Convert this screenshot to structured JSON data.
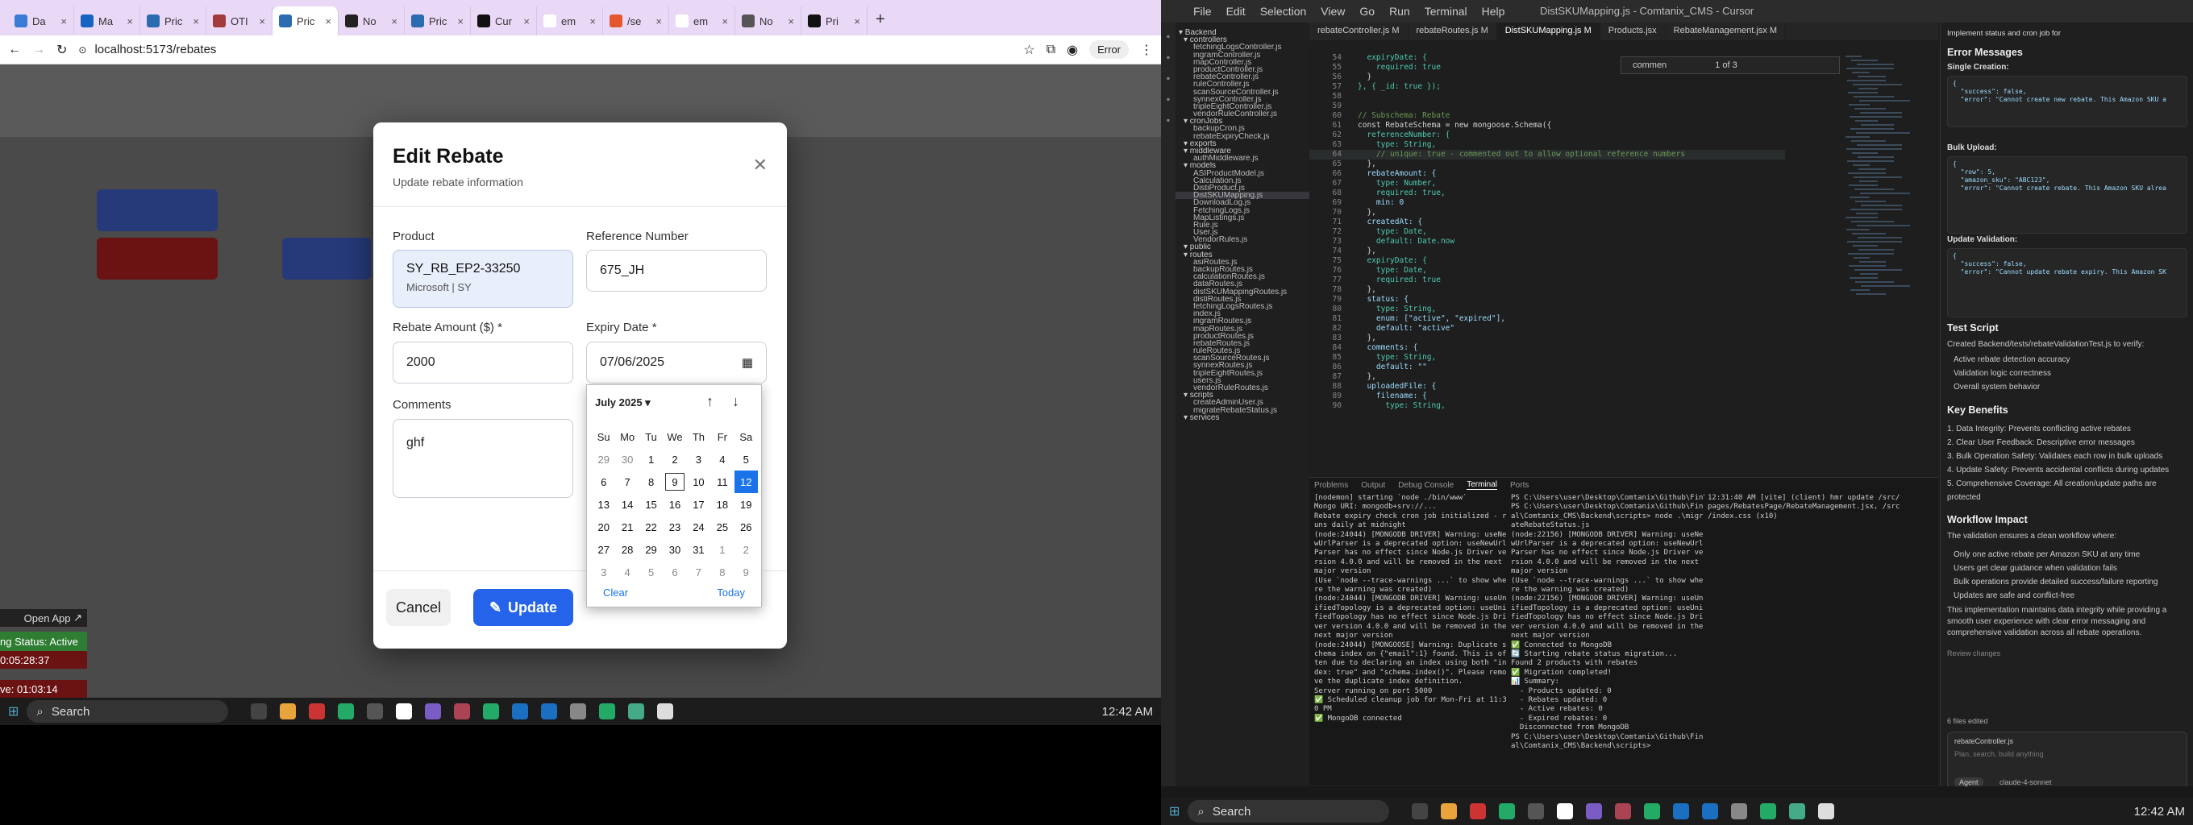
{
  "browser": {
    "tabs": [
      {
        "label": "Da"
      },
      {
        "label": "Ma"
      },
      {
        "label": "Pric"
      },
      {
        "label": "OTI"
      },
      {
        "label": "Pric"
      },
      {
        "label": "No"
      },
      {
        "label": "Pric"
      },
      {
        "label": "Cur"
      },
      {
        "label": "em"
      },
      {
        "label": "/se"
      },
      {
        "label": "em"
      },
      {
        "label": "No"
      },
      {
        "label": "Pri"
      }
    ],
    "url": "localhost:5173/rebates",
    "error_label": "Error"
  },
  "modal": {
    "title": "Edit Rebate",
    "subtitle": "Update rebate information",
    "product_label": "Product",
    "product_name": "SY_RB_EP2-33250",
    "product_meta": "Microsoft | SY",
    "reference_label": "Reference Number",
    "reference_value": "675_JH",
    "amount_label": "Rebate Amount ($) *",
    "amount_value": "2000",
    "expiry_label": "Expiry Date *",
    "expiry_value": "07/06/2025",
    "comments_label": "Comments",
    "comments_value": "ghf",
    "cancel_label": "Cancel",
    "update_label": "Update"
  },
  "calendar": {
    "month_label": "July 2025",
    "weekdays": [
      "Su",
      "Mo",
      "Tu",
      "We",
      "Th",
      "Fr",
      "Sa"
    ],
    "days": [
      "29",
      "30",
      "1",
      "2",
      "3",
      "4",
      "5",
      "6",
      "7",
      "8",
      "9",
      "10",
      "11",
      "12",
      "13",
      "14",
      "15",
      "16",
      "17",
      "18",
      "19",
      "20",
      "21",
      "22",
      "23",
      "24",
      "25",
      "26",
      "27",
      "28",
      "29",
      "30",
      "31",
      "1",
      "2",
      "3",
      "4",
      "5",
      "6",
      "7",
      "8",
      "9"
    ],
    "today_index": 10,
    "selected_index": 13,
    "clear_label": "Clear",
    "today_label": "Today"
  },
  "left_taskbar": {
    "search_label": "Search",
    "time": "12:42 AM",
    "open_app": "Open App",
    "status_active": "ng Status: Active",
    "status_time1": "0:05:28:37",
    "status_time2": "ve: 01:03:14"
  },
  "vscode": {
    "menu": [
      "File",
      "Edit",
      "Selection",
      "View",
      "Go",
      "Run",
      "Terminal",
      "Help"
    ],
    "window_title": "DistSKUMapping.js - Comtanix_CMS - Cursor",
    "editor_tabs": [
      "rebateController.js M",
      "rebateRoutes.js M",
      "DistSKUMapping.js M",
      "Products.jsx",
      "RebateManagement.jsx M"
    ],
    "find_text": "commen",
    "find_count": "1 of 3",
    "explorer": [
      "Backend",
      "controllers",
      "fetchingLogsController.js",
      "ingramController.js",
      "mapController.js",
      "productController.js",
      "rebateController.js",
      "ruleController.js",
      "scanSourceController.js",
      "synnexController.js",
      "tripleEightController.js",
      "vendorRuleController.js",
      "cronJobs",
      "backupCron.js",
      "rebateExpiryCheck.js",
      "exports",
      "middleware",
      "authMiddleware.js",
      "models",
      "ASIProductModel.js",
      "Calculation.js",
      "DistiProduct.js",
      "DistSKUMapping.js",
      "DownloadLog.js",
      "FetchingLogs.js",
      "MapListings.js",
      "Rule.js",
      "User.js",
      "VendorRules.js",
      "public",
      "routes",
      "asiRoutes.js",
      "backupRoutes.js",
      "calculationRoutes.js",
      "dataRoutes.js",
      "distSKUMappingRoutes.js",
      "distiRoutes.js",
      "fetchingLogsRoutes.js",
      "index.js",
      "ingramRoutes.js",
      "mapRoutes.js",
      "productRoutes.js",
      "rebateRoutes.js",
      "ruleRoutes.js",
      "scanSourceRoutes.js",
      "synnexRoutes.js",
      "tripleEightRoutes.js",
      "users.js",
      "vendorRuleRoutes.js",
      "scripts",
      "createAdminUser.js",
      "migrateRebateStatus.js",
      "services"
    ],
    "code_lines": [
      [
        "54",
        "  expiryDate: {"
      ],
      [
        "55",
        "    required: true"
      ],
      [
        "56",
        "  }"
      ],
      [
        "57",
        "}, { _id: true });"
      ],
      [
        "58",
        ""
      ],
      [
        "59",
        ""
      ],
      [
        "60",
        "// Subschema: Rebate"
      ],
      [
        "61",
        "const RebateSchema = new mongoose.Schema({"
      ],
      [
        "62",
        "  referenceNumber: {"
      ],
      [
        "63",
        "    type: String,"
      ],
      [
        "64",
        "    // unique: true - commented out to allow optional reference numbers"
      ],
      [
        "65",
        "  },"
      ],
      [
        "66",
        "  rebateAmount: {"
      ],
      [
        "67",
        "    type: Number,"
      ],
      [
        "68",
        "    required: true,"
      ],
      [
        "69",
        "    min: 0"
      ],
      [
        "70",
        "  },"
      ],
      [
        "71",
        "  createdAt: {"
      ],
      [
        "72",
        "    type: Date,"
      ],
      [
        "73",
        "    default: Date.now"
      ],
      [
        "74",
        "  },"
      ],
      [
        "75",
        "  expiryDate: {"
      ],
      [
        "76",
        "    type: Date,"
      ],
      [
        "77",
        "    required: true"
      ],
      [
        "78",
        "  },"
      ],
      [
        "79",
        "  status: {"
      ],
      [
        "80",
        "    type: String,"
      ],
      [
        "81",
        "    enum: [\"active\", \"expired\"],"
      ],
      [
        "82",
        "    default: \"active\""
      ],
      [
        "83",
        "  },"
      ],
      [
        "84",
        "  comments: {"
      ],
      [
        "85",
        "    type: String,"
      ],
      [
        "86",
        "    default: \"\""
      ],
      [
        "87",
        "  },"
      ],
      [
        "88",
        "  uploadedFile: {"
      ],
      [
        "89",
        "    filename: {"
      ],
      [
        "90",
        "      type: String,"
      ]
    ],
    "panel_tabs": [
      "Problems",
      "Output",
      "Debug Console",
      "Terminal",
      "Ports"
    ],
    "terminal_left": "[nodemon] starting `node ./bin/www`\nMongo URI: mongodb+srv://...\nRebate expiry check cron job initialized - r\nuns daily at midnight\n(node:24044) [MONGODB DRIVER] Warning: useNe\nwUrlParser is a deprecated option: useNewUrl\nParser has no effect since Node.js Driver ve\nrsion 4.0.0 and will be removed in the next\nmajor version\n(Use `node --trace-warnings ...` to show whe\nre the warning was created)\n(node:24044) [MONGODB DRIVER] Warning: useUn\nifiedTopology is a deprecated option: useUni\nfiedTopology has no effect since Node.js Dri\nver version 4.0.0 and will be removed in the\nnext major version\n(node:24044) [MONGOOSE] Warning: Duplicate s\nchema index on {\"email\":1} found. This is of\nten due to declaring an index using both \"in\ndex: true\" and \"schema.index()\". Please remo\nve the duplicate index definition.\nServer running on port 5000\n✅ Scheduled cleanup job for Mon-Fri at 11:3\n0 PM\n✅ MongoDB connected",
    "terminal_mid": "PS C:\\Users\\user\\Desktop\\Comtanix\\Github\\Fin\\Comtanix_CMS\\Backend> cd .\\scripts\\\nPS C:\\Users\\user\\Desktop\\Comtanix\\Github\\Fin\nal\\Comtanix_CMS\\Backend\\scripts> node .\\migr\nateRebateStatus.js\n(node:22156) [MONGODB DRIVER] Warning: useNe\nwUrlParser is a deprecated option: useNewUrl\nParser has no effect since Node.js Driver ve\nrsion 4.0.0 and will be removed in the next\nmajor version\n(Use `node --trace-warnings ...` to show whe\nre the warning was created)\n(node:22156) [MONGODB DRIVER] Warning: useUn\nifiedTopology is a deprecated option: useUni\nfiedTopology has no effect since Node.js Dri\nver version 4.0.0 and will be removed in the\nnext major version\n✅ Connected to MongoDB\n🔄 Starting rebate status migration...\nFound 2 products with rebates\n✅ Migration completed!\n📊 Summary:\n  - Products updated: 0\n  - Rebates updated: 0\n  - Active rebates: 0\n  - Expired rebates: 0\n  Disconnected from MongoDB\nPS C:\\Users\\user\\Desktop\\Comtanix\\Github\\Fin\nal\\Comtanix_CMS\\Backend\\scripts> ",
    "terminal_right": "12:31:40 AM [vite] (client) hmr update /src/\npages/RebatesPage/RebateManagement.jsx, /src\n/index.css (x10)",
    "status_time": "12:42 AM"
  },
  "chat": {
    "title": "Implement status and cron job for",
    "error_heading": "Error Messages",
    "single_creation": "Single Creation:",
    "single_json": "{\n  \"success\": false,\n  \"error\": \"Cannot create new rebate. This Amazon SKU a",
    "bulk_upload": "Bulk Upload:",
    "bulk_json": "{\n  \"row\": 5,\n  \"amazon_sku\": \"ABC123\",\n  \"error\": \"Cannot create rebate. This Amazon SKU alrea",
    "update_validation": "Update Validation:",
    "update_json": "{\n  \"success\": false,\n  \"error\": \"Cannot update rebate expiry. This Amazon SK",
    "test_heading": "Test Script",
    "test_text": "Created Backend/tests/rebateValidationTest.js to verify:",
    "test_items": [
      "Active rebate detection accuracy",
      "Validation logic correctness",
      "Overall system behavior"
    ],
    "benefits_heading": "Key Benefits",
    "benefits": [
      "1. Data Integrity: Prevents conflicting active rebates",
      "2. Clear User Feedback: Descriptive error messages",
      "3. Bulk Operation Safety: Validates each row in bulk uploads",
      "4. Update Safety: Prevents accidental conflicts during updates",
      "5. Comprehensive Coverage: All creation/update paths are",
      "protected"
    ],
    "workflow_heading": "Workflow Impact",
    "workflow_intro": "The validation ensures a clean workflow where:",
    "workflow_items": [
      "Only one active rebate per Amazon SKU at any time",
      "Users get clear guidance when validation fails",
      "Bulk operations provide detailed success/failure reporting",
      "Updates are safe and conflict-free"
    ],
    "summary": "This implementation maintains data integrity while providing a",
    "summary2": "smooth user experience with clear error messaging and",
    "summary3": "comprehensive validation across all rebate operations.",
    "review_changes": "Review changes",
    "files_edited": "6 files edited",
    "file_item": "rebateController.js",
    "input_placeholder": "Plan, search, build anything",
    "agent_label": "Agent",
    "model_label": "claude-4-sonnet"
  }
}
